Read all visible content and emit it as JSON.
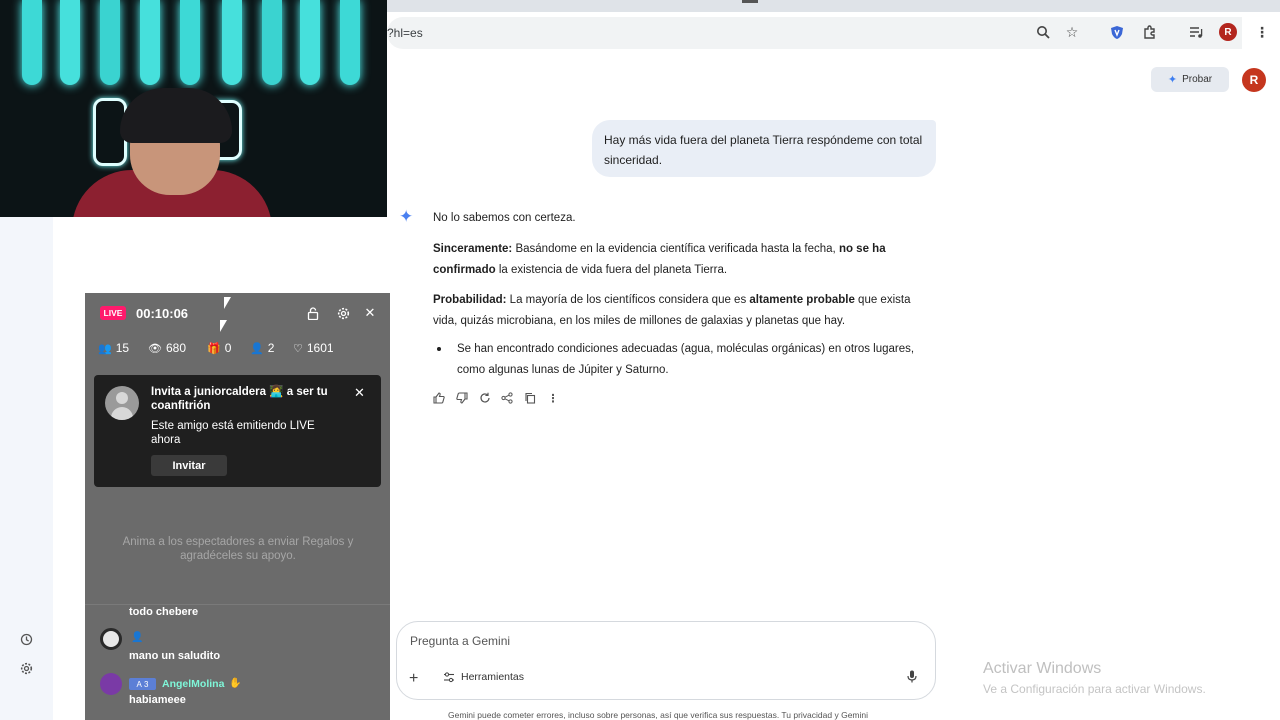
{
  "browser": {
    "url": "?hl=es",
    "profile_initial": "R",
    "icons": [
      "zoom-icon",
      "bookmark-star-icon",
      "shield-extension-icon",
      "puzzle-extensions-icon",
      "media-queue-icon",
      "more-vert-icon"
    ]
  },
  "gemini": {
    "try_button": "Probar",
    "avatar_initial": "R",
    "user_prompt": "Hay más vida fuera del planeta Tierra respóndeme con total sinceridad.",
    "response": {
      "intro": "No lo sabemos con certeza.",
      "p1_label": "Sinceramente:",
      "p1_a": " Basándome en la evidencia científica verificada hasta la fecha, ",
      "p1_bold": "no se ha confirmado",
      "p1_b": " la existencia de vida fuera del planeta Tierra.",
      "p2_label": "Probabilidad:",
      "p2_a": " La mayoría de los científicos considera que es ",
      "p2_bold": "altamente probable",
      "p2_b": " que exista vida, quizás microbiana, en los miles de millones de galaxias y planetas que hay.",
      "bullet": "Se han encontrado condiciones adecuadas (agua, moléculas orgánicas) en otros lugares, como algunas lunas de Júpiter y Saturno."
    },
    "input_placeholder": "Pregunta a Gemini",
    "tools_label": "Herramientas",
    "disclaimer": "Gemini puede cometer errores, incluso sobre personas, así que verifica sus respuestas. Tu privacidad y Gemini"
  },
  "windows_watermark": {
    "title": "Activar Windows",
    "subtitle": "Ve a Configuración para activar Windows."
  },
  "live_panel": {
    "badge": "LIVE",
    "timer": "00:10:06",
    "stats": {
      "viewers": "15",
      "views": "680",
      "gifts": "0",
      "new_followers": "2",
      "likes": "1601"
    },
    "invite": {
      "title": "Invita a juniorcaldera 👩‍💻 a ser tu coanfitrión",
      "description": "Este amigo está emitiendo LIVE ahora",
      "button": "Invitar"
    },
    "gift_hint": "Anima a los espectadores a enviar Regalos y agradéceles su apoyo.",
    "chat": [
      {
        "text": "todo chebere"
      },
      {
        "text": "mano un saludito"
      },
      {
        "level": "3",
        "name": "AngelMolina",
        "text": "habiameee"
      }
    ]
  }
}
